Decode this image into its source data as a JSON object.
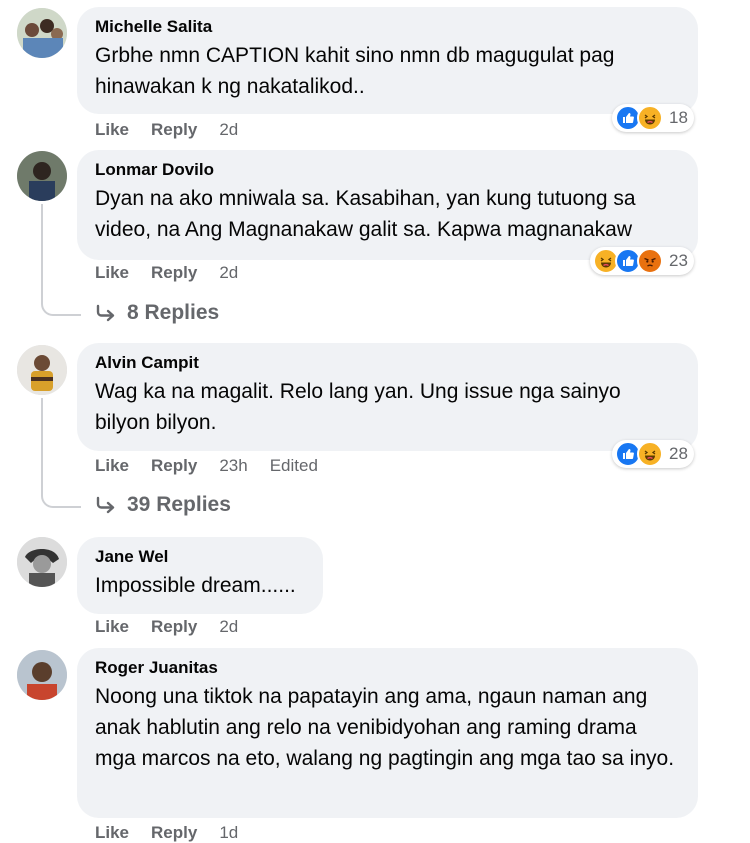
{
  "comments": [
    {
      "name": "Michelle Salita",
      "text": "Grbhe nmn CAPTION kahit sino nmn db magugulat pag hinawakan k ng nakatalikod..",
      "like": "Like",
      "reply": "Reply",
      "time": "2d",
      "reaction_count": "18",
      "reaction_icons": [
        "like-icon",
        "haha-icon"
      ]
    },
    {
      "name": "Lonmar Dovilo",
      "text": "Dyan na ako mniwala sa. Kasabihan, yan kung tutuong sa video, na Ang Magnanakaw galit sa. Kapwa magnanakaw",
      "like": "Like",
      "reply": "Reply",
      "time": "2d",
      "reaction_count": "23",
      "reaction_icons": [
        "haha-icon",
        "like-icon",
        "angry-icon"
      ],
      "replies_label": "8 Replies"
    },
    {
      "name": "Alvin Campit",
      "text": "Wag ka na magalit. Relo lang yan. Ung issue nga sainyo bilyon bilyon.",
      "like": "Like",
      "reply": "Reply",
      "time": "23h",
      "edited": "Edited",
      "reaction_count": "28",
      "reaction_icons": [
        "like-icon",
        "haha-icon"
      ],
      "replies_label": "39 Replies"
    },
    {
      "name": "Jane Wel",
      "text": "Impossible dream......",
      "like": "Like",
      "reply": "Reply",
      "time": "2d"
    },
    {
      "name": "Roger Juanitas",
      "text": "Noong una tiktok na papatayin ang ama, ngaun naman ang anak hablutin ang relo na venibidyohan ang raming drama mga marcos na eto, walang ng pagtingin ang mga tao sa inyo.",
      "like": "Like",
      "reply": "Reply",
      "time": "1d"
    }
  ],
  "colors": {
    "bubble": "#f0f2f5",
    "secondary_text": "#65676b",
    "like_blue": "#1877f2",
    "haha_yellow": "#f7b125",
    "angry_orange": "#e9710f"
  }
}
